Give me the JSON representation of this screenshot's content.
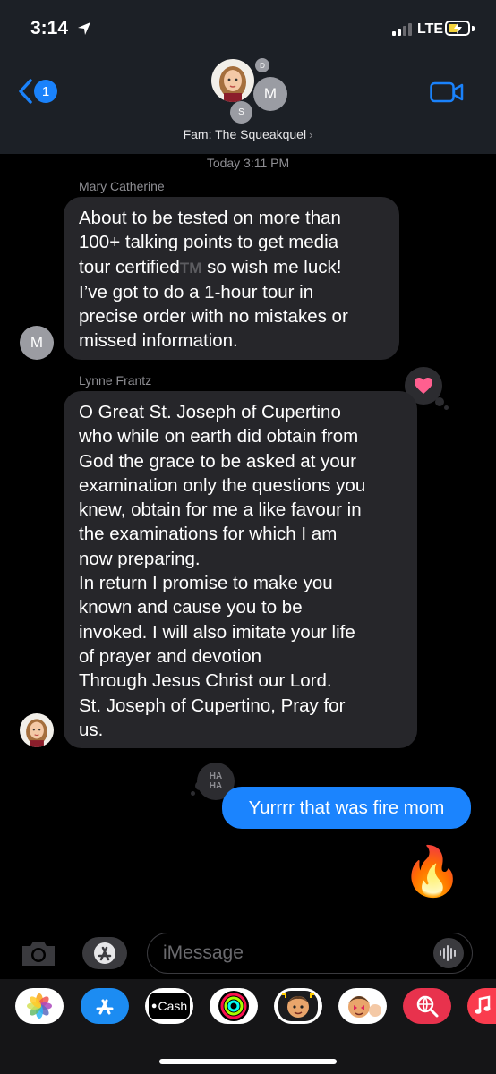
{
  "status_bar": {
    "time": "3:14",
    "network": "LTE"
  },
  "header": {
    "back_badge": "1",
    "group_name": "Fam: The Squeakquel",
    "member_initials": [
      "D",
      "M",
      "S"
    ]
  },
  "conversation": {
    "timestamp": "Today 3:11 PM",
    "messages": [
      {
        "sender": "Mary Catherine",
        "avatar_initial": "M",
        "lines": [
          "About to be tested on more than",
          "100+ talking points to get media",
          "tour certified",
          "so wish me luck!",
          "I’ve got to do a 1-hour tour in",
          "precise order with no mistakes or",
          "missed information."
        ],
        "trademark": "TM",
        "tapback": "heart"
      },
      {
        "sender": "Lynne Frantz",
        "lines": [
          "O Great St. Joseph of Cupertino",
          "who while on earth did obtain from",
          "God the grace to be asked at your",
          "examination only the questions you",
          "knew, obtain for me a like favour in",
          "the examinations for which I am",
          "now preparing.",
          "In return I promise to make you",
          "known and cause you to be",
          "invoked. I will also imitate your life",
          "of prayer and devotion",
          "Through Jesus Christ our Lord.",
          "St. Joseph of Cupertino, Pray for",
          "us."
        ],
        "tapback": "haha",
        "tapback_text": [
          "HA",
          "HA"
        ]
      },
      {
        "sender": "me",
        "text": "Yurrrr that was fire mom"
      },
      {
        "sender": "me",
        "emoji": "🔥"
      }
    ]
  },
  "composer": {
    "placeholder": "iMessage"
  },
  "app_tray": {
    "apps": [
      "photos-app",
      "app-store",
      "apple-cash",
      "fitness-activity",
      "memoji",
      "memoji-stickers",
      "web-images",
      "music"
    ],
    "cash_label": "Cash"
  },
  "colors": {
    "header_bg": "#1c2026",
    "incoming_bubble": "#26262a",
    "outgoing_bubble": "#1b84fe",
    "accent_blue": "#1a82fb",
    "heart_pink": "#ff5f8f"
  }
}
